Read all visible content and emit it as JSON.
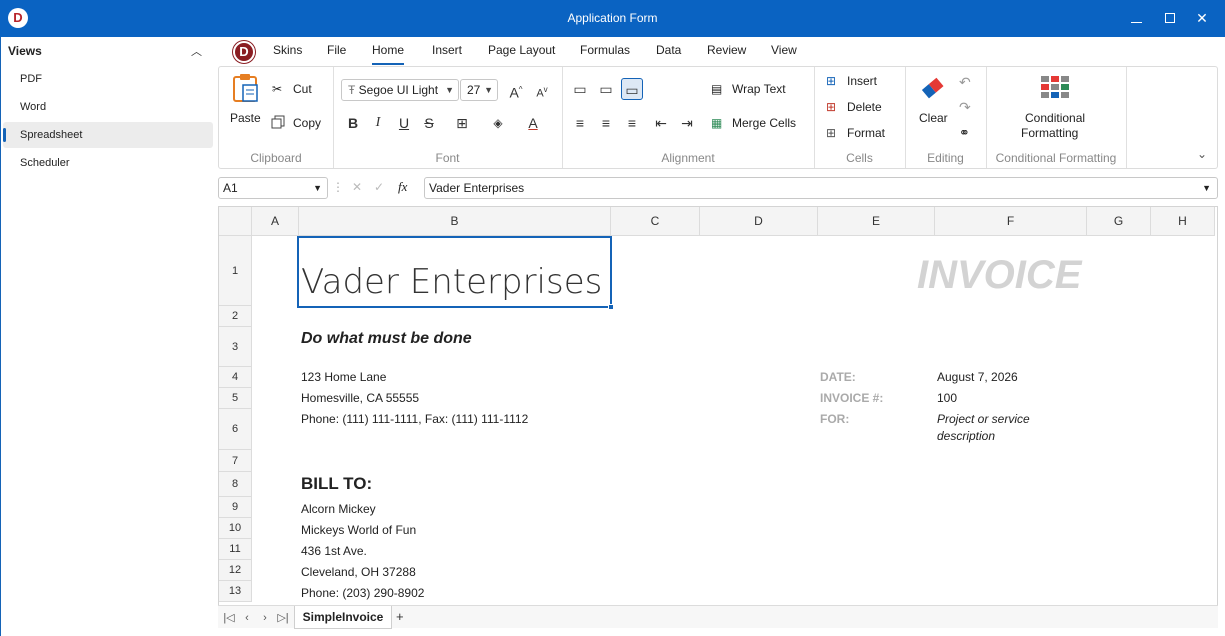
{
  "window": {
    "title": "Application Form"
  },
  "nav": {
    "header": "Views",
    "items": [
      {
        "label": "PDF"
      },
      {
        "label": "Word"
      },
      {
        "label": "Spreadsheet"
      },
      {
        "label": "Scheduler"
      }
    ]
  },
  "ribbon": {
    "tabs": [
      "Skins",
      "File",
      "Home",
      "Insert",
      "Page Layout",
      "Formulas",
      "Data",
      "Review",
      "View"
    ],
    "active_tab": "Home",
    "clipboard": {
      "paste": "Paste",
      "cut": "Cut",
      "copy": "Copy",
      "label": "Clipboard"
    },
    "font": {
      "family": "Segoe UI Light",
      "size": "27",
      "label": "Font"
    },
    "alignment": {
      "wrap": "Wrap Text",
      "merge": "Merge Cells",
      "label": "Alignment"
    },
    "cells": {
      "insert": "Insert",
      "delete": "Delete",
      "format": "Format",
      "label": "Cells"
    },
    "editing": {
      "clear": "Clear",
      "label": "Editing"
    },
    "cond": {
      "line1": "Conditional",
      "line2": "Formatting",
      "label": "Conditional Formatting"
    }
  },
  "formula_bar": {
    "cell_ref": "A1",
    "value": "Vader Enterprises"
  },
  "sheet": {
    "columns": [
      "A",
      "B",
      "C",
      "D",
      "E",
      "F",
      "G",
      "H"
    ],
    "rows": [
      "1",
      "2",
      "3",
      "4",
      "5",
      "6",
      "7",
      "8",
      "9",
      "10",
      "11",
      "12",
      "13"
    ],
    "company": "Vader Enterprises",
    "invoice_title": "INVOICE",
    "slogan": "Do what must be done",
    "address1": "123 Home Lane",
    "address2": "Homesville, CA 55555",
    "phone": "Phone: (111) 111-1111, Fax: (111) 111-1112",
    "date_label": "DATE:",
    "date_value": "August 7, 2026",
    "inv_label": "INVOICE #:",
    "inv_value": "100",
    "for_label": "FOR:",
    "for_value1": "Project or service",
    "for_value2": "description",
    "bill_to": "BILL TO:",
    "bill_name": "Alcorn Mickey",
    "bill_company": "Mickeys World of Fun",
    "bill_address": "436 1st Ave.",
    "bill_city": "Cleveland, OH 37288",
    "bill_phone": "Phone: (203) 290-8902"
  },
  "sheet_tabs": {
    "active": "SimpleInvoice"
  }
}
